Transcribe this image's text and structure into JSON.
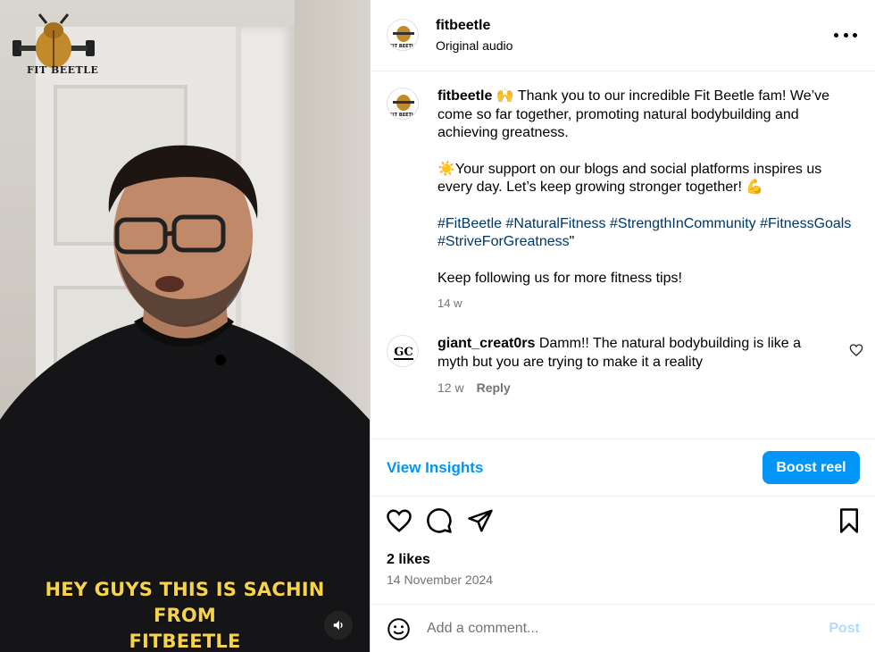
{
  "media": {
    "logo_text": "FIT BEETLE",
    "subtitle_line1": "HEY GUYS THIS IS SACHIN FROM",
    "subtitle_line2": "FITBEETLE"
  },
  "header": {
    "username": "fitbeetle",
    "audio_label": "Original audio",
    "avatar_text": "FIT BEETLE"
  },
  "caption": {
    "username": "fitbeetle",
    "line1_emoji": "🙌",
    "line1": " Thank you to our incredible Fit Beetle fam! We’ve come so far together, promoting natural bodybuilding and achieving greatness.",
    "line2_emoji": "☀️",
    "line2": "Your support on our blogs and social platforms inspires us every day. Let’s keep growing stronger together! ",
    "line2_end_emoji": "💪",
    "hashtags": [
      "#FitBeetle",
      "#NaturalFitness",
      "#StrengthInCommunity",
      "#FitnessGoals",
      "#StriveForGreatness"
    ],
    "hashtags_suffix": "\"",
    "line4": "Keep following us for more fitness tips!",
    "time_ago": "14 w"
  },
  "comment": {
    "username": "giant_creat0rs",
    "text": " Damm!! The natural bodybuilding is like a myth but you are trying to make it a reality",
    "time_ago": "12 w",
    "reply_label": "Reply",
    "avatar_text": "GC"
  },
  "insights": {
    "view_label": "View Insights",
    "boost_label": "Boost reel"
  },
  "stats": {
    "likes": "2 likes",
    "date": "14 November 2024"
  },
  "add_comment": {
    "placeholder": "Add a comment...",
    "post_label": "Post"
  },
  "colors": {
    "accent": "#0095f6",
    "hashtag": "#00376b",
    "muted": "#737373",
    "subtitle": "#f6d34a"
  }
}
